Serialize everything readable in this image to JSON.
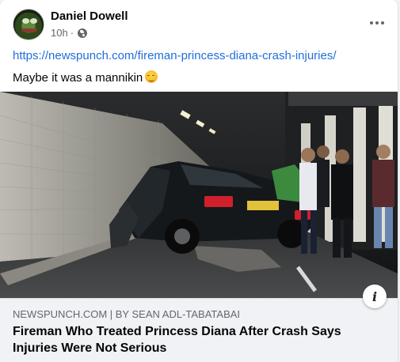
{
  "post": {
    "author": "Daniel Dowell",
    "timestamp": "10h",
    "separator": "·",
    "privacy_icon": "globe-icon",
    "link_url": "https://newspunch.com/fireman-princess-diana-crash-injuries/",
    "caption": "Maybe it was a mannikin",
    "caption_emoji": "relieved-face-emoji"
  },
  "link_preview": {
    "domain_line": "NEWSPUNCH.COM | BY SEAN ADL-TABATABAI",
    "headline": "Fireman Who Treated Princess Diana After Crash Says Injuries Were Not Serious",
    "info_glyph": "i"
  },
  "colors": {
    "link": "#216fdb",
    "secondary_text": "#65676b",
    "primary_text": "#050505",
    "preview_bg": "#f0f2f5"
  }
}
